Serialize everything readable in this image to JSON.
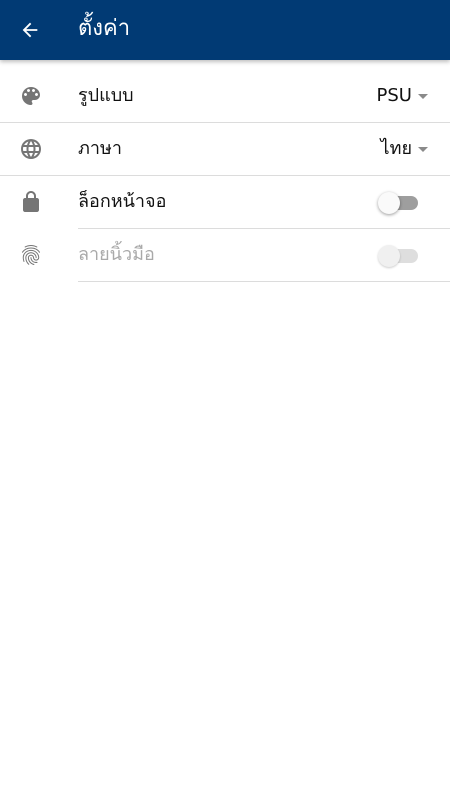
{
  "appbar": {
    "back_icon": "arrow-left-icon",
    "title": "ตั้งค่า",
    "color": "#013a74"
  },
  "settings": {
    "theme": {
      "icon": "palette-icon",
      "label": "รูปแบบ",
      "value": "PSU"
    },
    "language": {
      "icon": "globe-icon",
      "label": "ภาษา",
      "value": "ไทย"
    },
    "screen_lock": {
      "icon": "lock-icon",
      "label": "ล็อกหน้าจอ",
      "enabled": false
    },
    "fingerprint": {
      "icon": "fingerprint-icon",
      "label": "ลายนิ้วมือ",
      "enabled": false,
      "disabled": true
    }
  }
}
